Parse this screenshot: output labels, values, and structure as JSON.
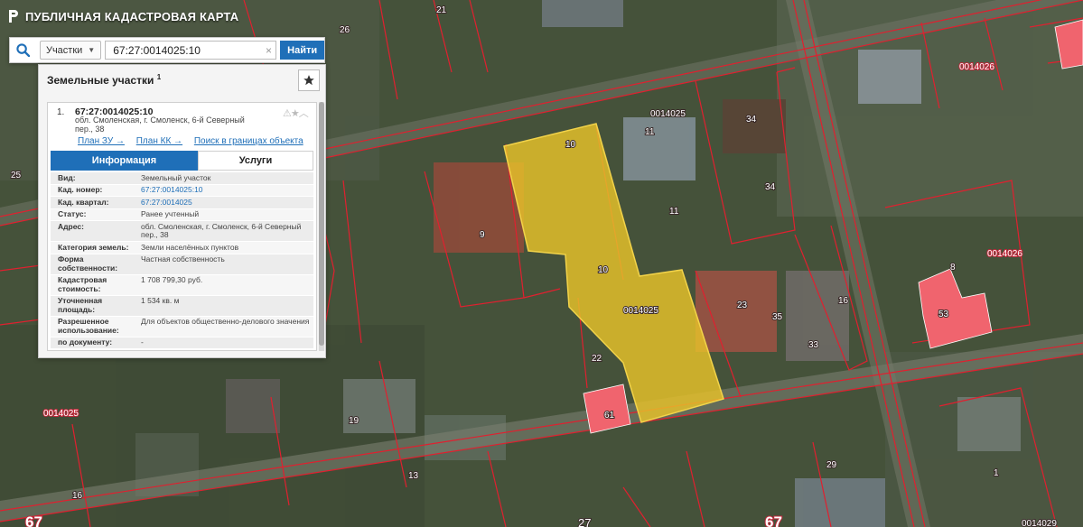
{
  "header": {
    "title": "ПУБЛИЧНАЯ КАДАСТРОВАЯ КАРТА"
  },
  "search": {
    "type_label": "Участки",
    "query": "67:27:0014025:10",
    "button_label": "Найти",
    "clear_label": "×"
  },
  "panel": {
    "title": "Земельные участки",
    "count": "1",
    "item": {
      "index": "1.",
      "cadastral_number": "67:27:0014025:10",
      "address": "обл. Смоленская, г. Смоленск, 6-й Северный пер., 38",
      "links": [
        "План ЗУ →",
        "План КК →",
        "Поиск в границах объекта →"
      ],
      "tabs": {
        "info": "Информация",
        "services": "Услуги"
      },
      "properties": [
        {
          "key": "Вид:",
          "value": "Земельный участок"
        },
        {
          "key": "Кад. номер:",
          "value": "67:27:0014025:10"
        },
        {
          "key": "Кад. квартал:",
          "value": "67:27:0014025"
        },
        {
          "key": "Статус:",
          "value": "Ранее учтенный"
        },
        {
          "key": "Адрес:",
          "value": "обл. Смоленская, г. Смоленск, 6-й Северный пер., 38"
        },
        {
          "key": "Категория земель:",
          "value": "Земли населённых пунктов"
        },
        {
          "key": "Форма собственности:",
          "value": "Частная собственность"
        },
        {
          "key": "Кадастровая стоимость:",
          "value": "1 708 799,30 руб."
        },
        {
          "key": "Уточненная площадь:",
          "value": "1 534 кв. м"
        },
        {
          "key": "Разрешенное использование:",
          "value": "Для объектов общественно-делового значения"
        },
        {
          "key": "по документу:",
          "value": "-"
        }
      ]
    }
  },
  "map_labels": {
    "l21": "21",
    "l26": "26",
    "l25": "25",
    "l9": "9",
    "l10a": "10",
    "l10b": "10",
    "q0014025_top": "0014025",
    "l11a": "11",
    "l11b": "11",
    "l34a": "34",
    "l34b": "34",
    "q0014026a": "0014026",
    "q0014026b": "0014026",
    "l8": "8",
    "l53": "53",
    "q0014025_center": "0014025",
    "l23": "23",
    "l35": "35",
    "l33": "33",
    "l16": "16",
    "l22": "22",
    "l61": "61",
    "q0014025_left": "0014025",
    "l19": "19",
    "l13": "13",
    "l16b": "16",
    "l29": "29",
    "l1": "1",
    "l67a": "67",
    "l67b": "67",
    "l27": "27",
    "q0014029": "0014029"
  },
  "colors": {
    "accent": "#1f6fb8",
    "parcel_highlight": "#e8c22a",
    "parcel_red": "#f0646e",
    "boundary": "#e0202f"
  }
}
